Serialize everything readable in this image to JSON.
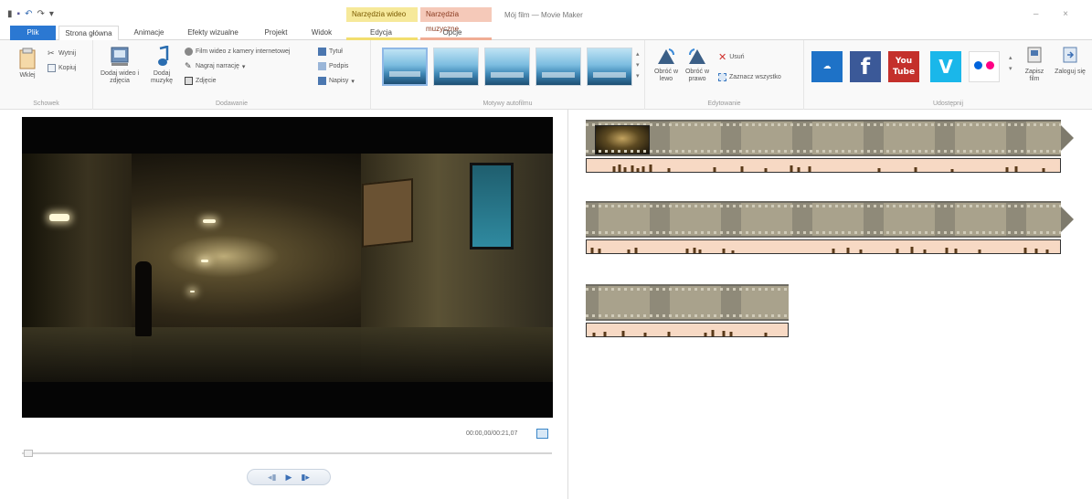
{
  "app": {
    "window_title": "Mój film — Movie Maker",
    "context_tabs": [
      "Narzędzia wideo",
      "Narzędzia muzyczne"
    ]
  },
  "tabs": [
    {
      "label": "Plik"
    },
    {
      "label": "Strona główna"
    },
    {
      "label": "Animacje"
    },
    {
      "label": "Efekty wizualne"
    },
    {
      "label": "Projekt"
    },
    {
      "label": "Widok"
    },
    {
      "label": "Edycja"
    },
    {
      "label": "Opcje"
    }
  ],
  "ribbon": {
    "clipboard": {
      "label": "Schowek",
      "paste": "Wklej",
      "cut": "Wytnij",
      "copy": "Kopiuj"
    },
    "add": {
      "label": "Dodawanie",
      "add_video_photos": "Dodaj wideo i zdjęcia",
      "add_music": "Dodaj muzykę",
      "webcam_video": "Film wideo z kamery internetowej",
      "record_narration": "Nagraj narrację",
      "snapshot": "Zdjęcie",
      "title": "Tytuł",
      "caption": "Podpis",
      "credits": "Napisy"
    },
    "themes": {
      "label": "Motywy autofilmu",
      "count": 5
    },
    "editing": {
      "label": "Edytowanie",
      "rotate_left": "Obróć w lewo",
      "rotate_right": "Obróć w prawo",
      "remove": "Usuń",
      "select_all": "Zaznacz wszystko"
    },
    "share": {
      "label": "Udostępnij",
      "save_movie": "Zapisz film",
      "sign_in": "Zaloguj się",
      "services": [
        {
          "name": "onedrive-icon",
          "color": "#1e72c7"
        },
        {
          "name": "facebook-icon",
          "color": "#3b5998"
        },
        {
          "name": "youtube-icon",
          "color": "#c4302b"
        },
        {
          "name": "vimeo-icon",
          "color": "#1ab7ea"
        },
        {
          "name": "flickr-icon",
          "color": "#0063dc"
        }
      ]
    }
  },
  "player": {
    "timecode": "00:00,00/00:21,07"
  }
}
